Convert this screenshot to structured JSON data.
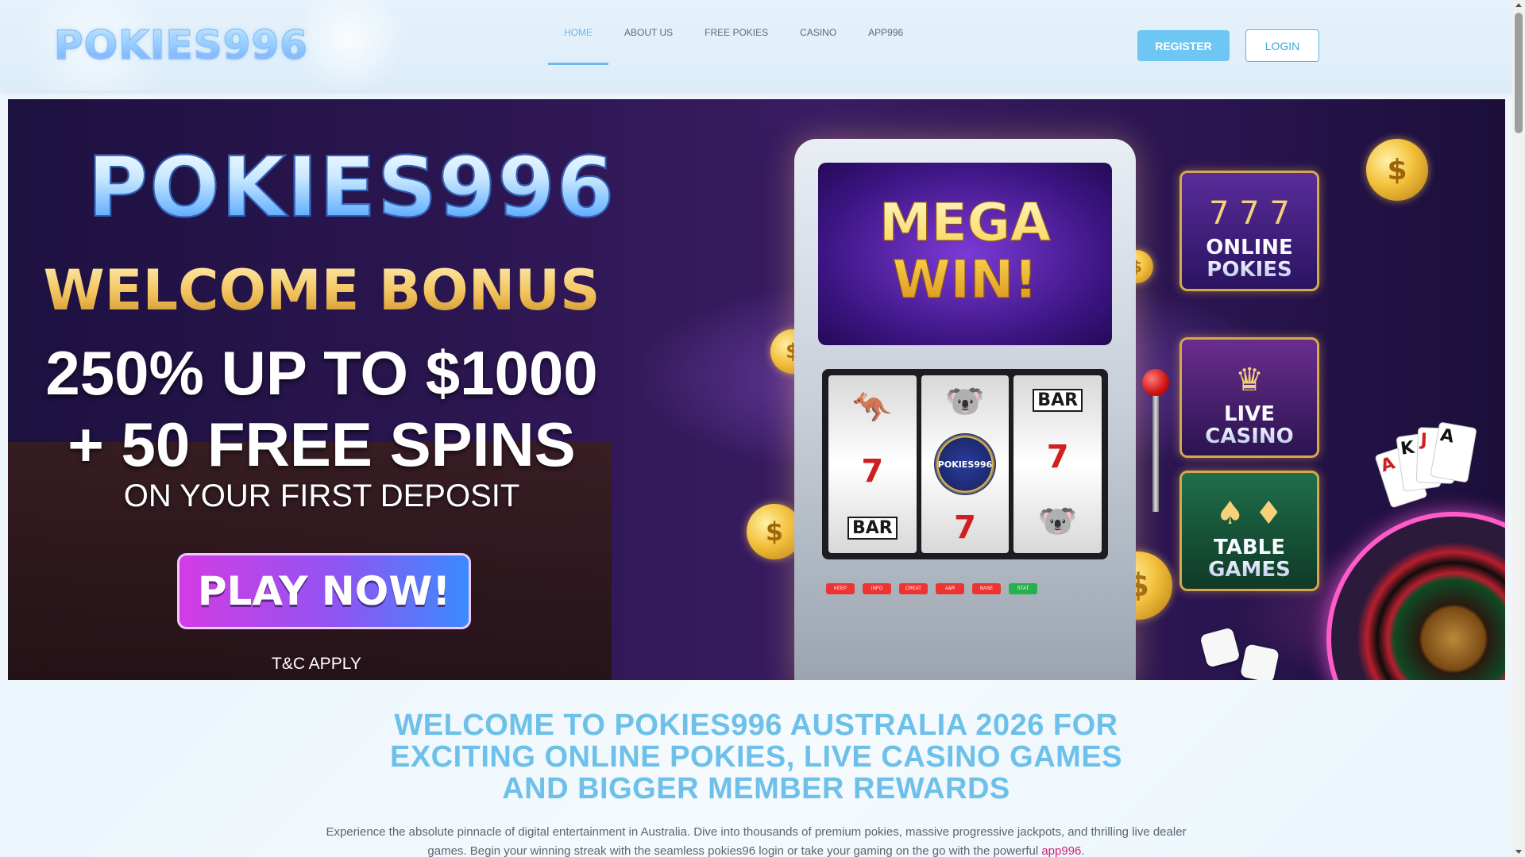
{
  "header": {
    "logo_text": "POKIES996",
    "nav": [
      {
        "label": "HOME",
        "active": true
      },
      {
        "label": "ABOUT US",
        "active": false
      },
      {
        "label": "FREE POKIES",
        "active": false
      },
      {
        "label": "CASINO",
        "active": false
      },
      {
        "label": "APP996",
        "active": false
      }
    ],
    "register_label": "REGISTER",
    "login_label": "LOGIN"
  },
  "banner": {
    "title": "POKIES996",
    "welcome": "WELCOME BONUS",
    "offer_line1": "250% UP TO $1000",
    "offer_line2": "+ 50 FREE SPINS",
    "deposit_line": "ON YOUR FIRST DEPOSIT",
    "play_label": "PLAY NOW!",
    "tnc": "T&C APPLY",
    "slot": {
      "headline_line1": "MEGA",
      "headline_line2": "WIN!",
      "reels": [
        [
          "🦘",
          "7",
          "BAR"
        ],
        [
          "🐨",
          "POKIES996",
          "7"
        ],
        [
          "BAR",
          "7",
          "🐨"
        ]
      ],
      "buttons": [
        "KEEP",
        "INFO",
        "CREAT",
        "A&R",
        "BASE",
        "STAT"
      ]
    },
    "side_cards": [
      {
        "label_line1": "ONLINE",
        "label_line2": "POKIES",
        "icon": "slot-777-icon"
      },
      {
        "label_line1": "LIVE",
        "label_line2": "CASINO",
        "icon": "dealer-icon"
      },
      {
        "label_line1": "TABLE",
        "label_line2": "GAMES",
        "icon": "playing-cards-icon"
      }
    ]
  },
  "content": {
    "heading": "WELCOME TO POKIES996 AUSTRALIA 2026 FOR EXCITING ONLINE POKIES, LIVE CASINO GAMES AND BIGGER MEMBER REWARDS",
    "paragraph_before_link": "Experience the absolute pinnacle of digital entertainment in Australia. Dive into thousands of premium pokies, massive progressive jackpots, and thrilling live dealer games. Begin your winning streak with the seamless pokies96 login or take your gaming on the go with the powerful ",
    "paragraph_link": "app996",
    "paragraph_after_link": "."
  },
  "colors": {
    "accent": "#6cb7ec",
    "register_bg": "#6ec6f2",
    "heading": "#6cc0e9",
    "link": "#d21f7a"
  }
}
